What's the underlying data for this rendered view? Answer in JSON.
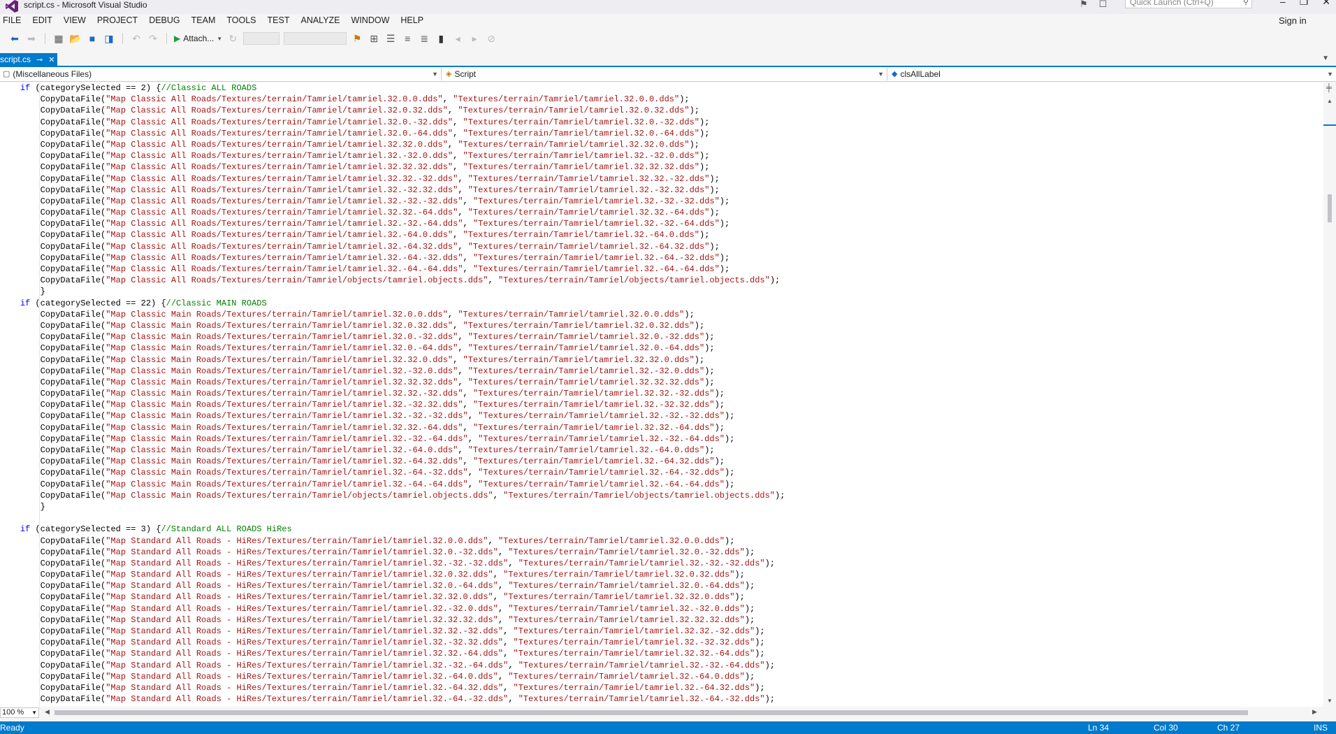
{
  "window": {
    "title": "script.cs - Microsoft Visual Studio",
    "quick_launch_placeholder": "Quick Launch (Ctrl+Q)",
    "sign_in": "Sign in"
  },
  "menu": [
    "FILE",
    "EDIT",
    "VIEW",
    "PROJECT",
    "DEBUG",
    "TEAM",
    "TOOLS",
    "TEST",
    "ANALYZE",
    "WINDOW",
    "HELP"
  ],
  "toolbar": {
    "attach_label": "Attach..."
  },
  "tab": {
    "label": "script.cs"
  },
  "navbar": {
    "project": "(Miscellaneous Files)",
    "type": "Script",
    "member": "clsAllLabel"
  },
  "code_lines": [
    [
      {
        "t": "    "
      },
      {
        "t": "if",
        "c": "kw"
      },
      {
        "t": " (categorySelected == 2) {"
      },
      {
        "t": "//Classic ALL ROADS",
        "c": "cmt"
      }
    ],
    [
      {
        "t": "        CopyDataFile("
      },
      {
        "t": "\"Map Classic All Roads/Textures/terrain/Tamriel/tamriel.32.0.0.dds\"",
        "c": "str"
      },
      {
        "t": ", "
      },
      {
        "t": "\"Textures/terrain/Tamriel/tamriel.32.0.0.dds\"",
        "c": "str"
      },
      {
        "t": ");"
      }
    ],
    [
      {
        "t": "        CopyDataFile("
      },
      {
        "t": "\"Map Classic All Roads/Textures/terrain/Tamriel/tamriel.32.0.32.dds\"",
        "c": "str"
      },
      {
        "t": ", "
      },
      {
        "t": "\"Textures/terrain/Tamriel/tamriel.32.0.32.dds\"",
        "c": "str"
      },
      {
        "t": ");"
      }
    ],
    [
      {
        "t": "        CopyDataFile("
      },
      {
        "t": "\"Map Classic All Roads/Textures/terrain/Tamriel/tamriel.32.0.-32.dds\"",
        "c": "str"
      },
      {
        "t": ", "
      },
      {
        "t": "\"Textures/terrain/Tamriel/tamriel.32.0.-32.dds\"",
        "c": "str"
      },
      {
        "t": ");"
      }
    ],
    [
      {
        "t": "        CopyDataFile("
      },
      {
        "t": "\"Map Classic All Roads/Textures/terrain/Tamriel/tamriel.32.0.-64.dds\"",
        "c": "str"
      },
      {
        "t": ", "
      },
      {
        "t": "\"Textures/terrain/Tamriel/tamriel.32.0.-64.dds\"",
        "c": "str"
      },
      {
        "t": ");"
      }
    ],
    [
      {
        "t": "        CopyDataFile("
      },
      {
        "t": "\"Map Classic All Roads/Textures/terrain/Tamriel/tamriel.32.32.0.dds\"",
        "c": "str"
      },
      {
        "t": ", "
      },
      {
        "t": "\"Textures/terrain/Tamriel/tamriel.32.32.0.dds\"",
        "c": "str"
      },
      {
        "t": ");"
      }
    ],
    [
      {
        "t": "        CopyDataFile("
      },
      {
        "t": "\"Map Classic All Roads/Textures/terrain/Tamriel/tamriel.32.-32.0.dds\"",
        "c": "str"
      },
      {
        "t": ", "
      },
      {
        "t": "\"Textures/terrain/Tamriel/tamriel.32.-32.0.dds\"",
        "c": "str"
      },
      {
        "t": ");"
      }
    ],
    [
      {
        "t": "        CopyDataFile("
      },
      {
        "t": "\"Map Classic All Roads/Textures/terrain/Tamriel/tamriel.32.32.32.dds\"",
        "c": "str"
      },
      {
        "t": ", "
      },
      {
        "t": "\"Textures/terrain/Tamriel/tamriel.32.32.32.dds\"",
        "c": "str"
      },
      {
        "t": ");"
      }
    ],
    [
      {
        "t": "        CopyDataFile("
      },
      {
        "t": "\"Map Classic All Roads/Textures/terrain/Tamriel/tamriel.32.32.-32.dds\"",
        "c": "str"
      },
      {
        "t": ", "
      },
      {
        "t": "\"Textures/terrain/Tamriel/tamriel.32.32.-32.dds\"",
        "c": "str"
      },
      {
        "t": ");"
      }
    ],
    [
      {
        "t": "        CopyDataFile("
      },
      {
        "t": "\"Map Classic All Roads/Textures/terrain/Tamriel/tamriel.32.-32.32.dds\"",
        "c": "str"
      },
      {
        "t": ", "
      },
      {
        "t": "\"Textures/terrain/Tamriel/tamriel.32.-32.32.dds\"",
        "c": "str"
      },
      {
        "t": ");"
      }
    ],
    [
      {
        "t": "        CopyDataFile("
      },
      {
        "t": "\"Map Classic All Roads/Textures/terrain/Tamriel/tamriel.32.-32.-32.dds\"",
        "c": "str"
      },
      {
        "t": ", "
      },
      {
        "t": "\"Textures/terrain/Tamriel/tamriel.32.-32.-32.dds\"",
        "c": "str"
      },
      {
        "t": ");"
      }
    ],
    [
      {
        "t": "        CopyDataFile("
      },
      {
        "t": "\"Map Classic All Roads/Textures/terrain/Tamriel/tamriel.32.32.-64.dds\"",
        "c": "str"
      },
      {
        "t": ", "
      },
      {
        "t": "\"Textures/terrain/Tamriel/tamriel.32.32.-64.dds\"",
        "c": "str"
      },
      {
        "t": ");"
      }
    ],
    [
      {
        "t": "        CopyDataFile("
      },
      {
        "t": "\"Map Classic All Roads/Textures/terrain/Tamriel/tamriel.32.-32.-64.dds\"",
        "c": "str"
      },
      {
        "t": ", "
      },
      {
        "t": "\"Textures/terrain/Tamriel/tamriel.32.-32.-64.dds\"",
        "c": "str"
      },
      {
        "t": ");"
      }
    ],
    [
      {
        "t": "        CopyDataFile("
      },
      {
        "t": "\"Map Classic All Roads/Textures/terrain/Tamriel/tamriel.32.-64.0.dds\"",
        "c": "str"
      },
      {
        "t": ", "
      },
      {
        "t": "\"Textures/terrain/Tamriel/tamriel.32.-64.0.dds\"",
        "c": "str"
      },
      {
        "t": ");"
      }
    ],
    [
      {
        "t": "        CopyDataFile("
      },
      {
        "t": "\"Map Classic All Roads/Textures/terrain/Tamriel/tamriel.32.-64.32.dds\"",
        "c": "str"
      },
      {
        "t": ", "
      },
      {
        "t": "\"Textures/terrain/Tamriel/tamriel.32.-64.32.dds\"",
        "c": "str"
      },
      {
        "t": ");"
      }
    ],
    [
      {
        "t": "        CopyDataFile("
      },
      {
        "t": "\"Map Classic All Roads/Textures/terrain/Tamriel/tamriel.32.-64.-32.dds\"",
        "c": "str"
      },
      {
        "t": ", "
      },
      {
        "t": "\"Textures/terrain/Tamriel/tamriel.32.-64.-32.dds\"",
        "c": "str"
      },
      {
        "t": ");"
      }
    ],
    [
      {
        "t": "        CopyDataFile("
      },
      {
        "t": "\"Map Classic All Roads/Textures/terrain/Tamriel/tamriel.32.-64.-64.dds\"",
        "c": "str"
      },
      {
        "t": ", "
      },
      {
        "t": "\"Textures/terrain/Tamriel/tamriel.32.-64.-64.dds\"",
        "c": "str"
      },
      {
        "t": ");"
      }
    ],
    [
      {
        "t": "        CopyDataFile("
      },
      {
        "t": "\"Map Classic All Roads/Textures/terrain/Tamriel/objects/tamriel.objects.dds\"",
        "c": "str"
      },
      {
        "t": ", "
      },
      {
        "t": "\"Textures/terrain/Tamriel/objects/tamriel.objects.dds\"",
        "c": "str"
      },
      {
        "t": ");"
      }
    ],
    [
      {
        "t": "        }"
      }
    ],
    [
      {
        "t": "    "
      },
      {
        "t": "if",
        "c": "kw"
      },
      {
        "t": " (categorySelected == 22) {"
      },
      {
        "t": "//Classic MAIN ROADS",
        "c": "cmt"
      }
    ],
    [
      {
        "t": "        CopyDataFile("
      },
      {
        "t": "\"Map Classic Main Roads/Textures/terrain/Tamriel/tamriel.32.0.0.dds\"",
        "c": "str"
      },
      {
        "t": ", "
      },
      {
        "t": "\"Textures/terrain/Tamriel/tamriel.32.0.0.dds\"",
        "c": "str"
      },
      {
        "t": ");"
      }
    ],
    [
      {
        "t": "        CopyDataFile("
      },
      {
        "t": "\"Map Classic Main Roads/Textures/terrain/Tamriel/tamriel.32.0.32.dds\"",
        "c": "str"
      },
      {
        "t": ", "
      },
      {
        "t": "\"Textures/terrain/Tamriel/tamriel.32.0.32.dds\"",
        "c": "str"
      },
      {
        "t": ");"
      }
    ],
    [
      {
        "t": "        CopyDataFile("
      },
      {
        "t": "\"Map Classic Main Roads/Textures/terrain/Tamriel/tamriel.32.0.-32.dds\"",
        "c": "str"
      },
      {
        "t": ", "
      },
      {
        "t": "\"Textures/terrain/Tamriel/tamriel.32.0.-32.dds\"",
        "c": "str"
      },
      {
        "t": ");"
      }
    ],
    [
      {
        "t": "        CopyDataFile("
      },
      {
        "t": "\"Map Classic Main Roads/Textures/terrain/Tamriel/tamriel.32.0.-64.dds\"",
        "c": "str"
      },
      {
        "t": ", "
      },
      {
        "t": "\"Textures/terrain/Tamriel/tamriel.32.0.-64.dds\"",
        "c": "str"
      },
      {
        "t": ");"
      }
    ],
    [
      {
        "t": "        CopyDataFile("
      },
      {
        "t": "\"Map Classic Main Roads/Textures/terrain/Tamriel/tamriel.32.32.0.dds\"",
        "c": "str"
      },
      {
        "t": ", "
      },
      {
        "t": "\"Textures/terrain/Tamriel/tamriel.32.32.0.dds\"",
        "c": "str"
      },
      {
        "t": ");"
      }
    ],
    [
      {
        "t": "        CopyDataFile("
      },
      {
        "t": "\"Map Classic Main Roads/Textures/terrain/Tamriel/tamriel.32.-32.0.dds\"",
        "c": "str"
      },
      {
        "t": ", "
      },
      {
        "t": "\"Textures/terrain/Tamriel/tamriel.32.-32.0.dds\"",
        "c": "str"
      },
      {
        "t": ");"
      }
    ],
    [
      {
        "t": "        CopyDataFile("
      },
      {
        "t": "\"Map Classic Main Roads/Textures/terrain/Tamriel/tamriel.32.32.32.dds\"",
        "c": "str"
      },
      {
        "t": ", "
      },
      {
        "t": "\"Textures/terrain/Tamriel/tamriel.32.32.32.dds\"",
        "c": "str"
      },
      {
        "t": ");"
      }
    ],
    [
      {
        "t": "        CopyDataFile("
      },
      {
        "t": "\"Map Classic Main Roads/Textures/terrain/Tamriel/tamriel.32.32.-32.dds\"",
        "c": "str"
      },
      {
        "t": ", "
      },
      {
        "t": "\"Textures/terrain/Tamriel/tamriel.32.32.-32.dds\"",
        "c": "str"
      },
      {
        "t": ");"
      }
    ],
    [
      {
        "t": "        CopyDataFile("
      },
      {
        "t": "\"Map Classic Main Roads/Textures/terrain/Tamriel/tamriel.32.-32.32.dds\"",
        "c": "str"
      },
      {
        "t": ", "
      },
      {
        "t": "\"Textures/terrain/Tamriel/tamriel.32.-32.32.dds\"",
        "c": "str"
      },
      {
        "t": ");"
      }
    ],
    [
      {
        "t": "        CopyDataFile("
      },
      {
        "t": "\"Map Classic Main Roads/Textures/terrain/Tamriel/tamriel.32.-32.-32.dds\"",
        "c": "str"
      },
      {
        "t": ", "
      },
      {
        "t": "\"Textures/terrain/Tamriel/tamriel.32.-32.-32.dds\"",
        "c": "str"
      },
      {
        "t": ");"
      }
    ],
    [
      {
        "t": "        CopyDataFile("
      },
      {
        "t": "\"Map Classic Main Roads/Textures/terrain/Tamriel/tamriel.32.32.-64.dds\"",
        "c": "str"
      },
      {
        "t": ", "
      },
      {
        "t": "\"Textures/terrain/Tamriel/tamriel.32.32.-64.dds\"",
        "c": "str"
      },
      {
        "t": ");"
      }
    ],
    [
      {
        "t": "        CopyDataFile("
      },
      {
        "t": "\"Map Classic Main Roads/Textures/terrain/Tamriel/tamriel.32.-32.-64.dds\"",
        "c": "str"
      },
      {
        "t": ", "
      },
      {
        "t": "\"Textures/terrain/Tamriel/tamriel.32.-32.-64.dds\"",
        "c": "str"
      },
      {
        "t": ");"
      }
    ],
    [
      {
        "t": "        CopyDataFile("
      },
      {
        "t": "\"Map Classic Main Roads/Textures/terrain/Tamriel/tamriel.32.-64.0.dds\"",
        "c": "str"
      },
      {
        "t": ", "
      },
      {
        "t": "\"Textures/terrain/Tamriel/tamriel.32.-64.0.dds\"",
        "c": "str"
      },
      {
        "t": ");"
      }
    ],
    [
      {
        "t": "        CopyDataFile("
      },
      {
        "t": "\"Map Classic Main Roads/Textures/terrain/Tamriel/tamriel.32.-64.32.dds\"",
        "c": "str"
      },
      {
        "t": ", "
      },
      {
        "t": "\"Textures/terrain/Tamriel/tamriel.32.-64.32.dds\"",
        "c": "str"
      },
      {
        "t": ");"
      }
    ],
    [
      {
        "t": "        CopyDataFile("
      },
      {
        "t": "\"Map Classic Main Roads/Textures/terrain/Tamriel/tamriel.32.-64.-32.dds\"",
        "c": "str"
      },
      {
        "t": ", "
      },
      {
        "t": "\"Textures/terrain/Tamriel/tamriel.32.-64.-32.dds\"",
        "c": "str"
      },
      {
        "t": ");"
      }
    ],
    [
      {
        "t": "        CopyDataFile("
      },
      {
        "t": "\"Map Classic Main Roads/Textures/terrain/Tamriel/tamriel.32.-64.-64.dds\"",
        "c": "str"
      },
      {
        "t": ", "
      },
      {
        "t": "\"Textures/terrain/Tamriel/tamriel.32.-64.-64.dds\"",
        "c": "str"
      },
      {
        "t": ");"
      }
    ],
    [
      {
        "t": "        CopyDataFile("
      },
      {
        "t": "\"Map Classic Main Roads/Textures/terrain/Tamriel/objects/tamriel.objects.dds\"",
        "c": "str"
      },
      {
        "t": ", "
      },
      {
        "t": "\"Textures/terrain/Tamriel/objects/tamriel.objects.dds\"",
        "c": "str"
      },
      {
        "t": ");"
      }
    ],
    [
      {
        "t": "        }"
      }
    ],
    [
      {
        "t": ""
      }
    ],
    [
      {
        "t": "    "
      },
      {
        "t": "if",
        "c": "kw"
      },
      {
        "t": " (categorySelected == 3) {"
      },
      {
        "t": "//Standard ALL ROADS HiRes",
        "c": "cmt"
      }
    ],
    [
      {
        "t": "        CopyDataFile("
      },
      {
        "t": "\"Map Standard All Roads - HiRes/Textures/terrain/Tamriel/tamriel.32.0.0.dds\"",
        "c": "str"
      },
      {
        "t": ", "
      },
      {
        "t": "\"Textures/terrain/Tamriel/tamriel.32.0.0.dds\"",
        "c": "str"
      },
      {
        "t": ");"
      }
    ],
    [
      {
        "t": "        CopyDataFile("
      },
      {
        "t": "\"Map Standard All Roads - HiRes/Textures/terrain/Tamriel/tamriel.32.0.-32.dds\"",
        "c": "str"
      },
      {
        "t": ", "
      },
      {
        "t": "\"Textures/terrain/Tamriel/tamriel.32.0.-32.dds\"",
        "c": "str"
      },
      {
        "t": ");"
      }
    ],
    [
      {
        "t": "        CopyDataFile("
      },
      {
        "t": "\"Map Standard All Roads - HiRes/Textures/terrain/Tamriel/tamriel.32.-32.-32.dds\"",
        "c": "str"
      },
      {
        "t": ", "
      },
      {
        "t": "\"Textures/terrain/Tamriel/tamriel.32.-32.-32.dds\"",
        "c": "str"
      },
      {
        "t": ");"
      }
    ],
    [
      {
        "t": "        CopyDataFile("
      },
      {
        "t": "\"Map Standard All Roads - HiRes/Textures/terrain/Tamriel/tamriel.32.0.32.dds\"",
        "c": "str"
      },
      {
        "t": ", "
      },
      {
        "t": "\"Textures/terrain/Tamriel/tamriel.32.0.32.dds\"",
        "c": "str"
      },
      {
        "t": ");"
      }
    ],
    [
      {
        "t": "        CopyDataFile("
      },
      {
        "t": "\"Map Standard All Roads - HiRes/Textures/terrain/Tamriel/tamriel.32.0.-64.dds\"",
        "c": "str"
      },
      {
        "t": ", "
      },
      {
        "t": "\"Textures/terrain/Tamriel/tamriel.32.0.-64.dds\"",
        "c": "str"
      },
      {
        "t": ");"
      }
    ],
    [
      {
        "t": "        CopyDataFile("
      },
      {
        "t": "\"Map Standard All Roads - HiRes/Textures/terrain/Tamriel/tamriel.32.32.0.dds\"",
        "c": "str"
      },
      {
        "t": ", "
      },
      {
        "t": "\"Textures/terrain/Tamriel/tamriel.32.32.0.dds\"",
        "c": "str"
      },
      {
        "t": ");"
      }
    ],
    [
      {
        "t": "        CopyDataFile("
      },
      {
        "t": "\"Map Standard All Roads - HiRes/Textures/terrain/Tamriel/tamriel.32.-32.0.dds\"",
        "c": "str"
      },
      {
        "t": ", "
      },
      {
        "t": "\"Textures/terrain/Tamriel/tamriel.32.-32.0.dds\"",
        "c": "str"
      },
      {
        "t": ");"
      }
    ],
    [
      {
        "t": "        CopyDataFile("
      },
      {
        "t": "\"Map Standard All Roads - HiRes/Textures/terrain/Tamriel/tamriel.32.32.32.dds\"",
        "c": "str"
      },
      {
        "t": ", "
      },
      {
        "t": "\"Textures/terrain/Tamriel/tamriel.32.32.32.dds\"",
        "c": "str"
      },
      {
        "t": ");"
      }
    ],
    [
      {
        "t": "        CopyDataFile("
      },
      {
        "t": "\"Map Standard All Roads - HiRes/Textures/terrain/Tamriel/tamriel.32.32.-32.dds\"",
        "c": "str"
      },
      {
        "t": ", "
      },
      {
        "t": "\"Textures/terrain/Tamriel/tamriel.32.32.-32.dds\"",
        "c": "str"
      },
      {
        "t": ");"
      }
    ],
    [
      {
        "t": "        CopyDataFile("
      },
      {
        "t": "\"Map Standard All Roads - HiRes/Textures/terrain/Tamriel/tamriel.32.-32.32.dds\"",
        "c": "str"
      },
      {
        "t": ", "
      },
      {
        "t": "\"Textures/terrain/Tamriel/tamriel.32.-32.32.dds\"",
        "c": "str"
      },
      {
        "t": ");"
      }
    ],
    [
      {
        "t": "        CopyDataFile("
      },
      {
        "t": "\"Map Standard All Roads - HiRes/Textures/terrain/Tamriel/tamriel.32.32.-64.dds\"",
        "c": "str"
      },
      {
        "t": ", "
      },
      {
        "t": "\"Textures/terrain/Tamriel/tamriel.32.32.-64.dds\"",
        "c": "str"
      },
      {
        "t": ");"
      }
    ],
    [
      {
        "t": "        CopyDataFile("
      },
      {
        "t": "\"Map Standard All Roads - HiRes/Textures/terrain/Tamriel/tamriel.32.-32.-64.dds\"",
        "c": "str"
      },
      {
        "t": ", "
      },
      {
        "t": "\"Textures/terrain/Tamriel/tamriel.32.-32.-64.dds\"",
        "c": "str"
      },
      {
        "t": ");"
      }
    ],
    [
      {
        "t": "        CopyDataFile("
      },
      {
        "t": "\"Map Standard All Roads - HiRes/Textures/terrain/Tamriel/tamriel.32.-64.0.dds\"",
        "c": "str"
      },
      {
        "t": ", "
      },
      {
        "t": "\"Textures/terrain/Tamriel/tamriel.32.-64.0.dds\"",
        "c": "str"
      },
      {
        "t": ");"
      }
    ],
    [
      {
        "t": "        CopyDataFile("
      },
      {
        "t": "\"Map Standard All Roads - HiRes/Textures/terrain/Tamriel/tamriel.32.-64.32.dds\"",
        "c": "str"
      },
      {
        "t": ", "
      },
      {
        "t": "\"Textures/terrain/Tamriel/tamriel.32.-64.32.dds\"",
        "c": "str"
      },
      {
        "t": ");"
      }
    ],
    [
      {
        "t": "        CopyDataFile("
      },
      {
        "t": "\"Map Standard All Roads - HiRes/Textures/terrain/Tamriel/tamriel.32.-64.-32.dds\"",
        "c": "str"
      },
      {
        "t": ", "
      },
      {
        "t": "\"Textures/terrain/Tamriel/tamriel.32.-64.-32.dds\"",
        "c": "str"
      },
      {
        "t": ");"
      }
    ]
  ],
  "zoom": "100 %",
  "status": {
    "ready": "Ready",
    "ln": "Ln 34",
    "col": "Col 30",
    "ch": "Ch 27",
    "ins": "INS"
  },
  "icons": {
    "logo": "vs-logo-icon",
    "feedback": "feedback-icon",
    "search": "search-icon"
  },
  "colors": {
    "accent": "#007acc",
    "keyword": "#0000ff",
    "string": "#a31515",
    "comment": "#008000"
  }
}
